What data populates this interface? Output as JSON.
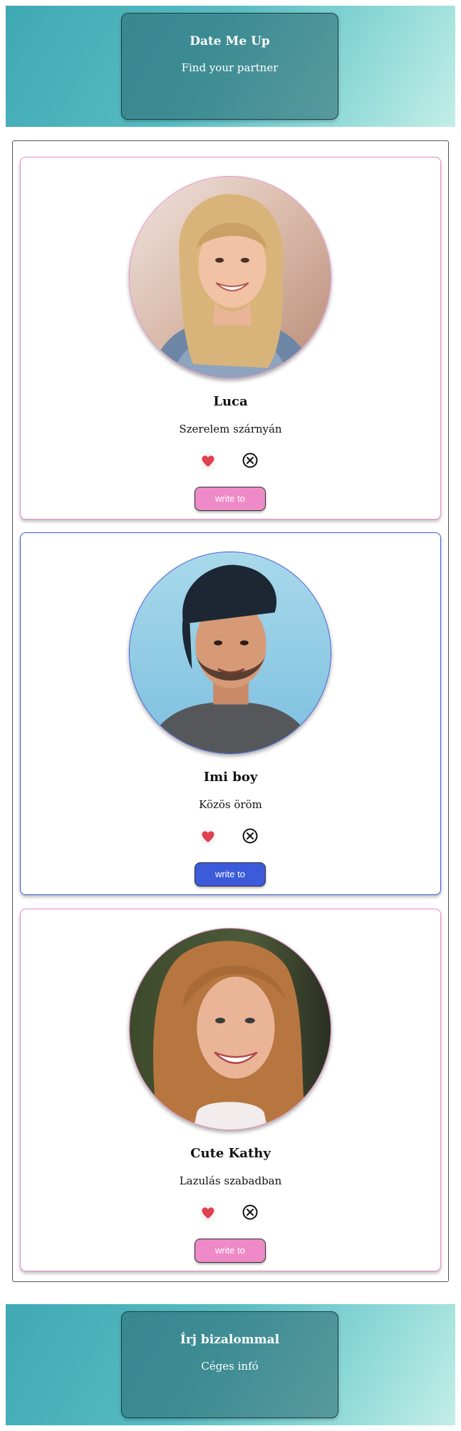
{
  "header": {
    "title": "Date Me Up",
    "subtitle": "Find your partner"
  },
  "profiles": [
    {
      "name": "Luca",
      "tagline": "Szerelem szárnyán",
      "write_label": "write to",
      "accent": "#ea8cc6"
    },
    {
      "name": "Imi boy",
      "tagline": "Közös öröm",
      "write_label": "write to",
      "accent": "#3a57d8"
    },
    {
      "name": "Cute Kathy",
      "tagline": "Lazulás szabadban",
      "write_label": "write to",
      "accent": "#ea8cc6"
    }
  ],
  "footer": {
    "title": "Írj bizalommal",
    "subtitle": "Céges infó"
  },
  "icons": {
    "like": "heart-icon",
    "dismiss": "close-circle-icon"
  },
  "colors": {
    "pink": "#ee8ac7",
    "blue": "#3b5bdb",
    "teal": "#3fa9b3",
    "heart": "#e0404f"
  }
}
